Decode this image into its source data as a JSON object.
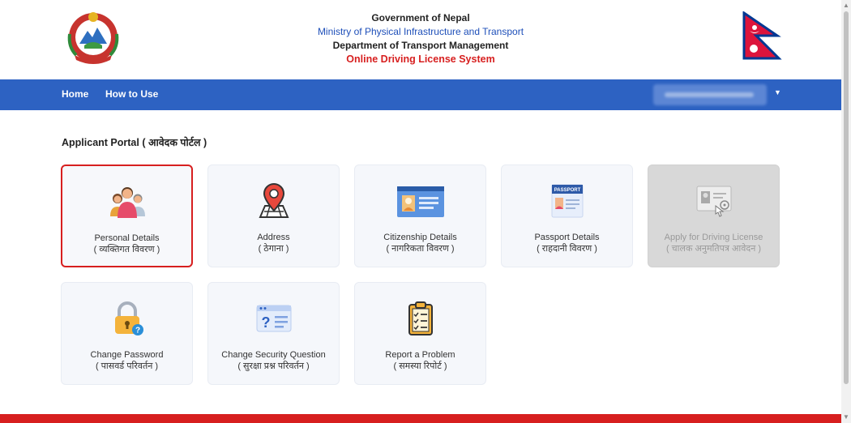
{
  "header": {
    "line1": "Government of Nepal",
    "line2": "Ministry of Physical Infrastructure and Transport",
    "line3": "Department of Transport Management",
    "line4": "Online Driving License System"
  },
  "nav": {
    "home": "Home",
    "how_to_use": "How to Use",
    "caret": "▼"
  },
  "portal_title": "Applicant Portal ( आवेदक पोर्टल )",
  "cards": [
    {
      "label": "Personal Details",
      "label_np": "( व्यक्तिगत विवरण )",
      "icon": "people-icon",
      "selected": true
    },
    {
      "label": "Address",
      "label_np": "( ठेगाना )",
      "icon": "map-pin-icon"
    },
    {
      "label": "Citizenship Details",
      "label_np": "( नागरिकता विवरण )",
      "icon": "id-card-icon"
    },
    {
      "label": "Passport Details",
      "label_np": "( राहदानी विवरण )",
      "icon": "passport-icon",
      "icon_text": "PASSPORT"
    },
    {
      "label": "Apply for Driving License",
      "label_np": "( चालक अनुमतिपत्र आवेदन )",
      "icon": "license-apply-icon",
      "disabled": true
    },
    {
      "label": "Change Password",
      "label_np": "( पासवर्ड परिवर्तन )",
      "icon": "lock-icon"
    },
    {
      "label": "Change Security Question",
      "label_np": "( सुरक्षा प्रश्न परिवर्तन )",
      "icon": "security-question-icon"
    },
    {
      "label": "Report a Problem",
      "label_np": "( समस्या रिपोर्ट )",
      "icon": "clipboard-icon"
    }
  ],
  "colors": {
    "navbar": "#2d62c2",
    "accent_red": "#d71f1f",
    "accent_blue": "#1e4fb9"
  }
}
